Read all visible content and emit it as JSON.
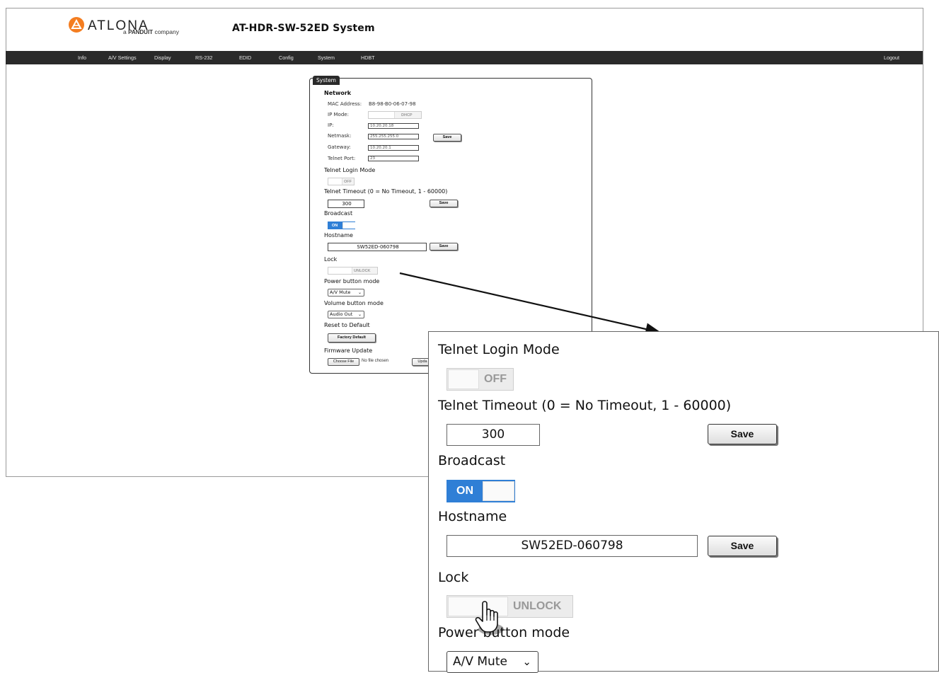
{
  "header": {
    "brand": "ATLONA",
    "brand_sub_prefix": "a",
    "brand_sub_bold": "PANDUIT",
    "brand_sub_suffix": "company",
    "title": "AT-HDR-SW-52ED  System"
  },
  "nav": {
    "items": [
      "Info",
      "A/V Settings",
      "Display",
      "RS-232",
      "EDID",
      "Config",
      "System",
      "HDBT"
    ],
    "logout": "Logout"
  },
  "panel": {
    "tab": "System",
    "network": {
      "heading": "Network",
      "mac_label": "MAC Address:",
      "mac_value": "B8-98-B0-06-07-98",
      "ip_mode_label": "IP Mode:",
      "ip_mode_value": "DHCP",
      "ip_label": "IP:",
      "ip_value": "10.20.20.18",
      "netmask_label": "Netmask:",
      "netmask_value": "255.255.255.0",
      "gateway_label": "Gateway:",
      "gateway_value": "10.20.20.1",
      "telnet_port_label": "Telnet Port:",
      "telnet_port_value": "23",
      "save": "Save"
    },
    "telnet_login": {
      "heading": "Telnet Login Mode",
      "state": "OFF"
    },
    "telnet_timeout": {
      "heading": "Telnet Timeout (0 = No Timeout, 1 - 60000)",
      "value": "300",
      "save": "Save"
    },
    "broadcast": {
      "heading": "Broadcast",
      "state": "ON"
    },
    "hostname": {
      "heading": "Hostname",
      "value": "SW52ED-060798",
      "save": "Save"
    },
    "lock": {
      "heading": "Lock",
      "state": "UNLOCK"
    },
    "power_button": {
      "heading": "Power button mode",
      "value": "A/V Mute"
    },
    "volume_button": {
      "heading": "Volume button mode",
      "value": "Audio Out"
    },
    "reset": {
      "heading": "Reset to Default",
      "button": "Factory Default"
    },
    "firmware": {
      "heading": "Firmware Update",
      "choose": "Choose File",
      "no_file": "No file chosen",
      "update": "Upda"
    }
  },
  "zoom": {
    "telnet_login_heading": "Telnet Login Mode",
    "telnet_login_state": "OFF",
    "telnet_timeout_heading": "Telnet Timeout (0 = No Timeout, 1 - 60000)",
    "telnet_timeout_value": "300",
    "save": "Save",
    "broadcast_heading": "Broadcast",
    "broadcast_state": "ON",
    "hostname_heading": "Hostname",
    "hostname_value": "SW52ED-060798",
    "lock_heading": "Lock",
    "lock_state": "UNLOCK",
    "power_heading": "Power button mode",
    "power_value": "A/V Mute"
  },
  "colors": {
    "navbar": "#2a2a2a",
    "toggle_on": "#2f7fd6",
    "toggle_off": "#f3f3f3"
  },
  "icons": [
    "atlona-logo-icon",
    "chevron-down-icon",
    "hand-cursor-icon",
    "callout-arrow-icon"
  ]
}
